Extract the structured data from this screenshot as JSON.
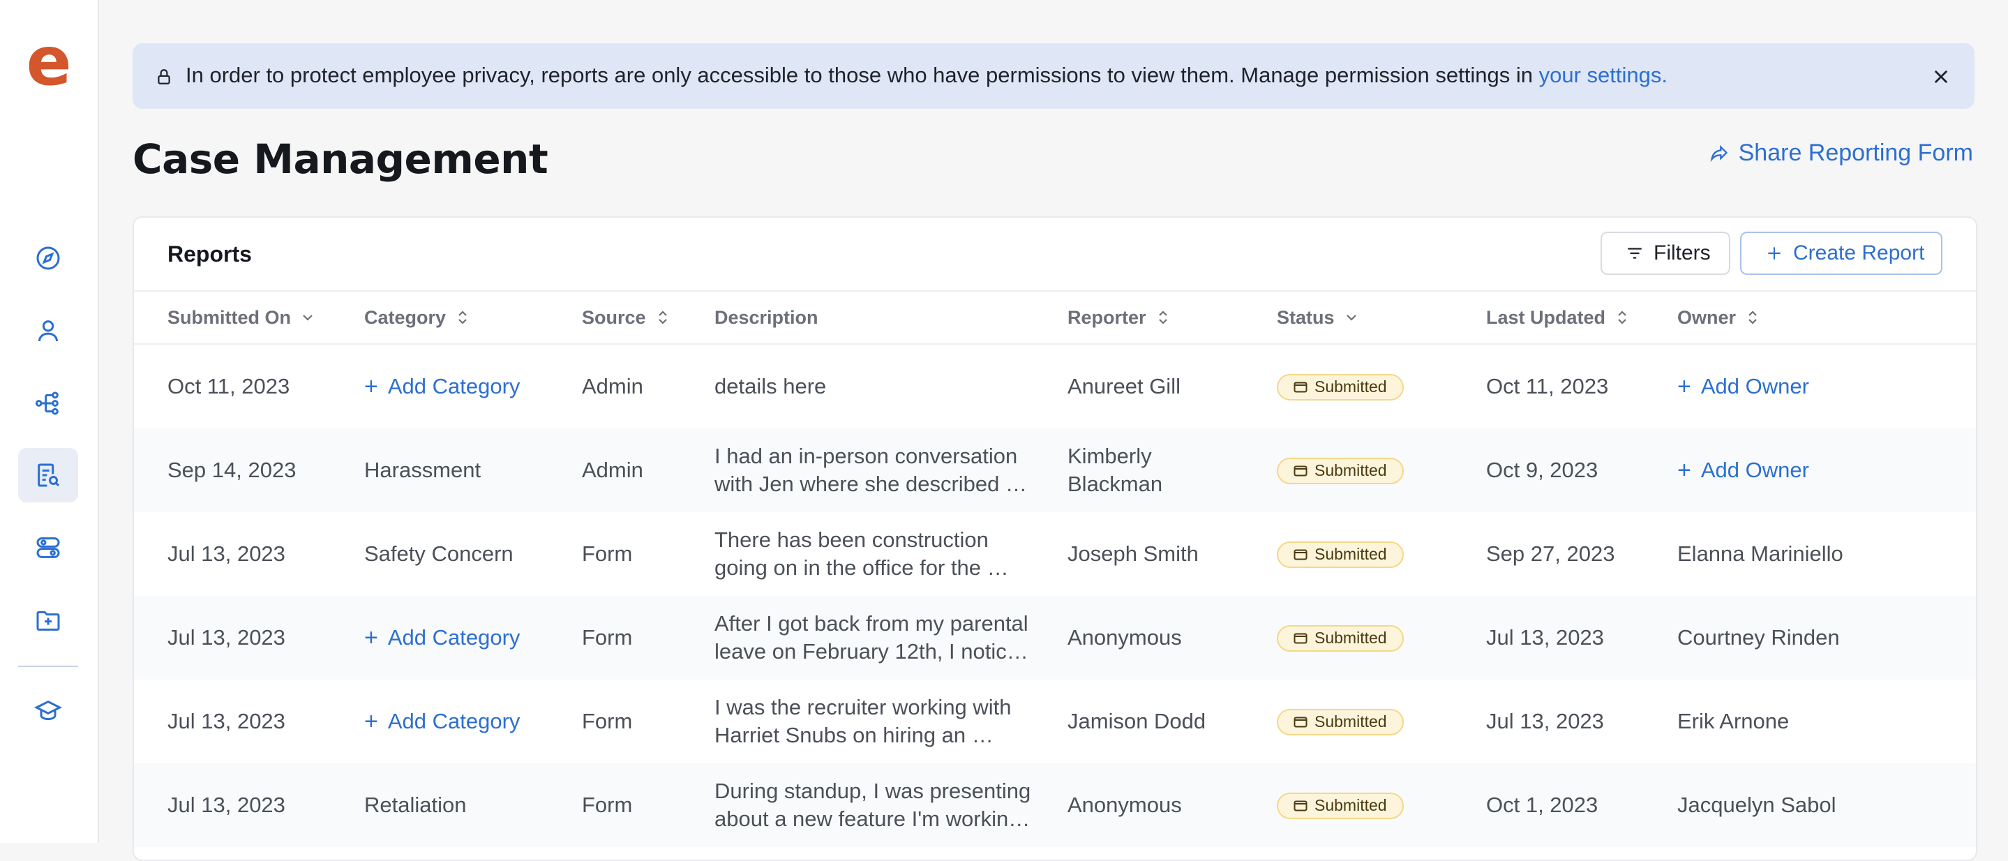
{
  "app": {
    "logo_letter": "e"
  },
  "sidebar": {
    "items": [
      {
        "icon": "compass-icon",
        "active": false
      },
      {
        "icon": "user-icon",
        "active": false
      },
      {
        "icon": "org-chart-icon",
        "active": false
      },
      {
        "icon": "report-search-icon",
        "active": true
      },
      {
        "icon": "toggles-icon",
        "active": false
      },
      {
        "icon": "folder-plus-icon",
        "active": false
      },
      {
        "icon": "graduation-cap-icon",
        "active": false
      }
    ]
  },
  "banner": {
    "message": "In order to protect employee privacy, reports are only accessible to those who have permissions to view them. Manage permission settings in ",
    "link_text": "your settings.",
    "lock_icon": "lock-icon",
    "close_icon": "close-icon"
  },
  "page": {
    "title": "Case Management",
    "share_label": "Share Reporting Form"
  },
  "reports": {
    "title": "Reports",
    "filters_label": "Filters",
    "create_label": "Create Report",
    "columns": [
      {
        "label": "Submitted On",
        "sort": "desc"
      },
      {
        "label": "Category",
        "sort": "both"
      },
      {
        "label": "Source",
        "sort": "both"
      },
      {
        "label": "Description",
        "sort": "none"
      },
      {
        "label": "Reporter",
        "sort": "both"
      },
      {
        "label": "Status",
        "sort": "desc"
      },
      {
        "label": "Last Updated",
        "sort": "both"
      },
      {
        "label": "Owner",
        "sort": "both"
      }
    ],
    "rows": [
      {
        "submitted": "Oct 11, 2023",
        "category": "",
        "source": "Admin",
        "description": "details here",
        "reporter": "Anureet Gill",
        "status": "Submitted",
        "last_updated": "Oct 11, 2023",
        "owner": ""
      },
      {
        "submitted": "Sep 14, 2023",
        "category": "Harassment",
        "source": "Admin",
        "description": "I had an in-person conversation with Jen where she described …",
        "reporter": "Kimberly Blackman",
        "status": "Submitted",
        "last_updated": "Oct 9, 2023",
        "owner": ""
      },
      {
        "submitted": "Jul 13, 2023",
        "category": "Safety Concern",
        "source": "Form",
        "description": "There has been construction going on in the office for the …",
        "reporter": "Joseph Smith",
        "status": "Submitted",
        "last_updated": "Sep 27, 2023",
        "owner": "Elanna Mariniello"
      },
      {
        "submitted": "Jul 13, 2023",
        "category": "",
        "source": "Form",
        "description": "After I got back from my parental leave on February 12th, I notic…",
        "reporter": "Anonymous",
        "status": "Submitted",
        "last_updated": "Jul 13, 2023",
        "owner": "Courtney Rinden"
      },
      {
        "submitted": "Jul 13, 2023",
        "category": "",
        "source": "Form",
        "description": "I was the recruiter working with Harriet Snubs on hiring an …",
        "reporter": "Jamison Dodd",
        "status": "Submitted",
        "last_updated": "Jul 13, 2023",
        "owner": "Erik Arnone"
      },
      {
        "submitted": "Jul 13, 2023",
        "category": "Retaliation",
        "source": "Form",
        "description": "During standup, I was presenting about a new feature I'm workin…",
        "reporter": "Anonymous",
        "status": "Submitted",
        "last_updated": "Oct 1, 2023",
        "owner": "Jacquelyn Sabol"
      }
    ],
    "add_category_label": "Add Category",
    "add_owner_label": "Add Owner"
  },
  "colors": {
    "accent": "#2c6fd1",
    "logo": "#d4562c",
    "banner_bg": "#dfe6f5",
    "badge_bg": "#fdf4dc",
    "badge_border": "#f3d889"
  }
}
